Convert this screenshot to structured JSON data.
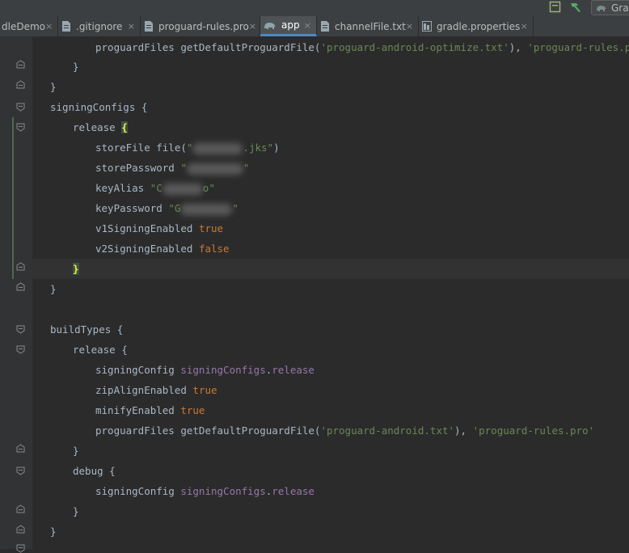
{
  "topbar": {
    "gradle_button_label": "Gra"
  },
  "tabs": [
    {
      "label": "dleDemo",
      "icon": "gradle-file-icon",
      "active": false
    },
    {
      "label": ".gitignore",
      "icon": "text-file-icon",
      "active": false
    },
    {
      "label": "proguard-rules.pro",
      "icon": "text-file-icon",
      "active": false
    },
    {
      "label": "app",
      "icon": "gradle-elephant-icon",
      "active": true
    },
    {
      "label": "channelFile.txt",
      "icon": "text-file-icon",
      "active": false
    },
    {
      "label": "gradle.properties",
      "icon": "properties-file-icon",
      "active": false
    }
  ],
  "tab_close_glyph": "×",
  "code": {
    "l1": {
      "a": "proguardFiles getDefaultProguardFile(",
      "b": "'proguard-android-optimize.txt'",
      "c": "), ",
      "d": "'proguard-rules.pro'"
    },
    "l2": "}",
    "l3": "}",
    "l4": "signingConfigs {",
    "l5": {
      "a": "release ",
      "b": "{"
    },
    "l6": {
      "a": "storeFile file(",
      "b": "\"",
      "c": ".jks\"",
      "d": ")"
    },
    "l7": {
      "a": "storePassword ",
      "b": "\"",
      "c": "\""
    },
    "l8": {
      "a": "keyAlias ",
      "b": "\"C",
      "c": "o\""
    },
    "l9": {
      "a": "keyPassword ",
      "b": "\"G",
      "c": "\""
    },
    "l10": {
      "a": "v1SigningEnabled ",
      "b": "true"
    },
    "l11": {
      "a": "v2SigningEnabled ",
      "b": "false"
    },
    "l12": "}",
    "l13": "}",
    "l14": "buildTypes {",
    "l15": "release {",
    "l16": {
      "a": "signingConfig ",
      "b": "signingConfigs",
      "c": ".",
      "d": "release"
    },
    "l17": {
      "a": "zipAlignEnabled ",
      "b": "true"
    },
    "l18": {
      "a": "minifyEnabled ",
      "b": "true"
    },
    "l19": {
      "a": "proguardFiles getDefaultProguardFile(",
      "b": "'proguard-android.txt'",
      "c": "), ",
      "d": "'proguard-rules.pro'"
    },
    "l20": "}",
    "l21": "debug {",
    "l22": {
      "a": "signingConfig ",
      "b": "signingConfigs",
      "c": ".",
      "d": "release"
    },
    "l23": "}",
    "l24": "}"
  },
  "colors": {
    "keyword": "#cc7832",
    "string": "#6a8759",
    "property": "#9876aa",
    "text": "#a9b7c6",
    "background": "#2b2b2b",
    "tab_active_underline": "#4a88c7"
  }
}
